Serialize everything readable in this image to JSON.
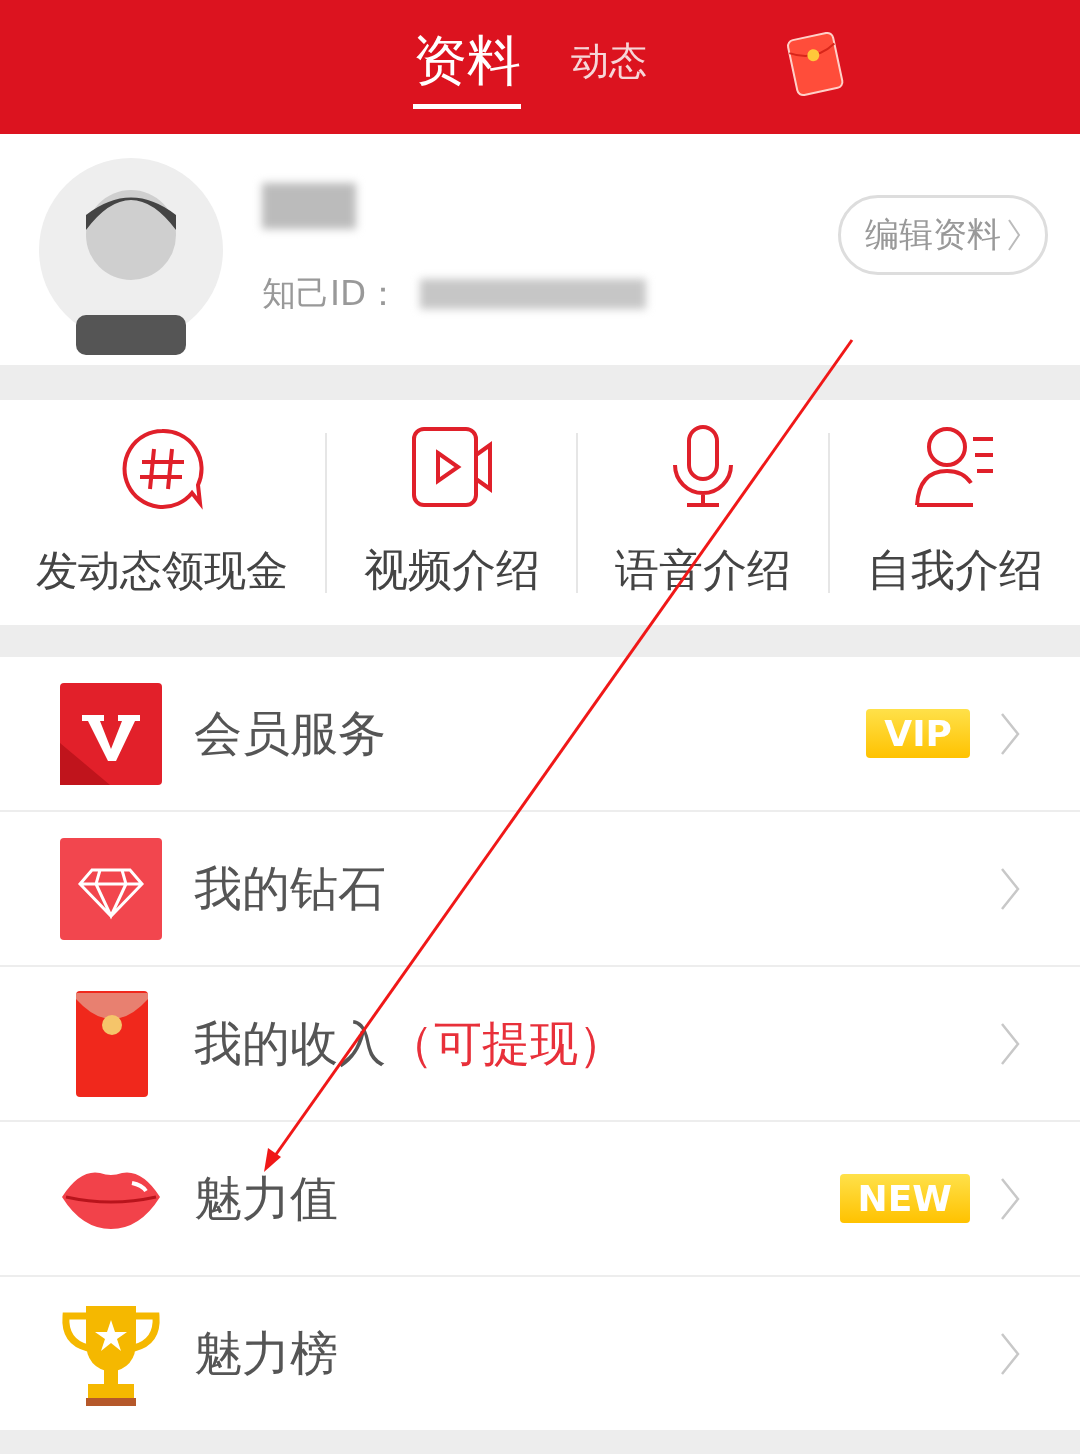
{
  "tabs": [
    {
      "label": "资料",
      "selected": true
    },
    {
      "label": "动态",
      "selected": false
    }
  ],
  "profile": {
    "id_label": "知己ID：",
    "edit_button": "编辑资料"
  },
  "quick_actions": [
    {
      "label": "发动态领现金",
      "kind": "hashtag"
    },
    {
      "label": "视频介绍",
      "kind": "video"
    },
    {
      "label": "语音介绍",
      "kind": "mic"
    },
    {
      "label": "自我介绍",
      "kind": "person"
    }
  ],
  "menu": [
    {
      "label": "会员服务",
      "kind": "vip",
      "badge": "VIP"
    },
    {
      "label": "我的钻石",
      "kind": "diamond"
    },
    {
      "label": "我的收入",
      "note": "（可提现）",
      "kind": "envelope"
    },
    {
      "label": "魅力值",
      "kind": "lips",
      "badge": "NEW"
    },
    {
      "label": "魅力榜",
      "kind": "trophy"
    }
  ]
}
